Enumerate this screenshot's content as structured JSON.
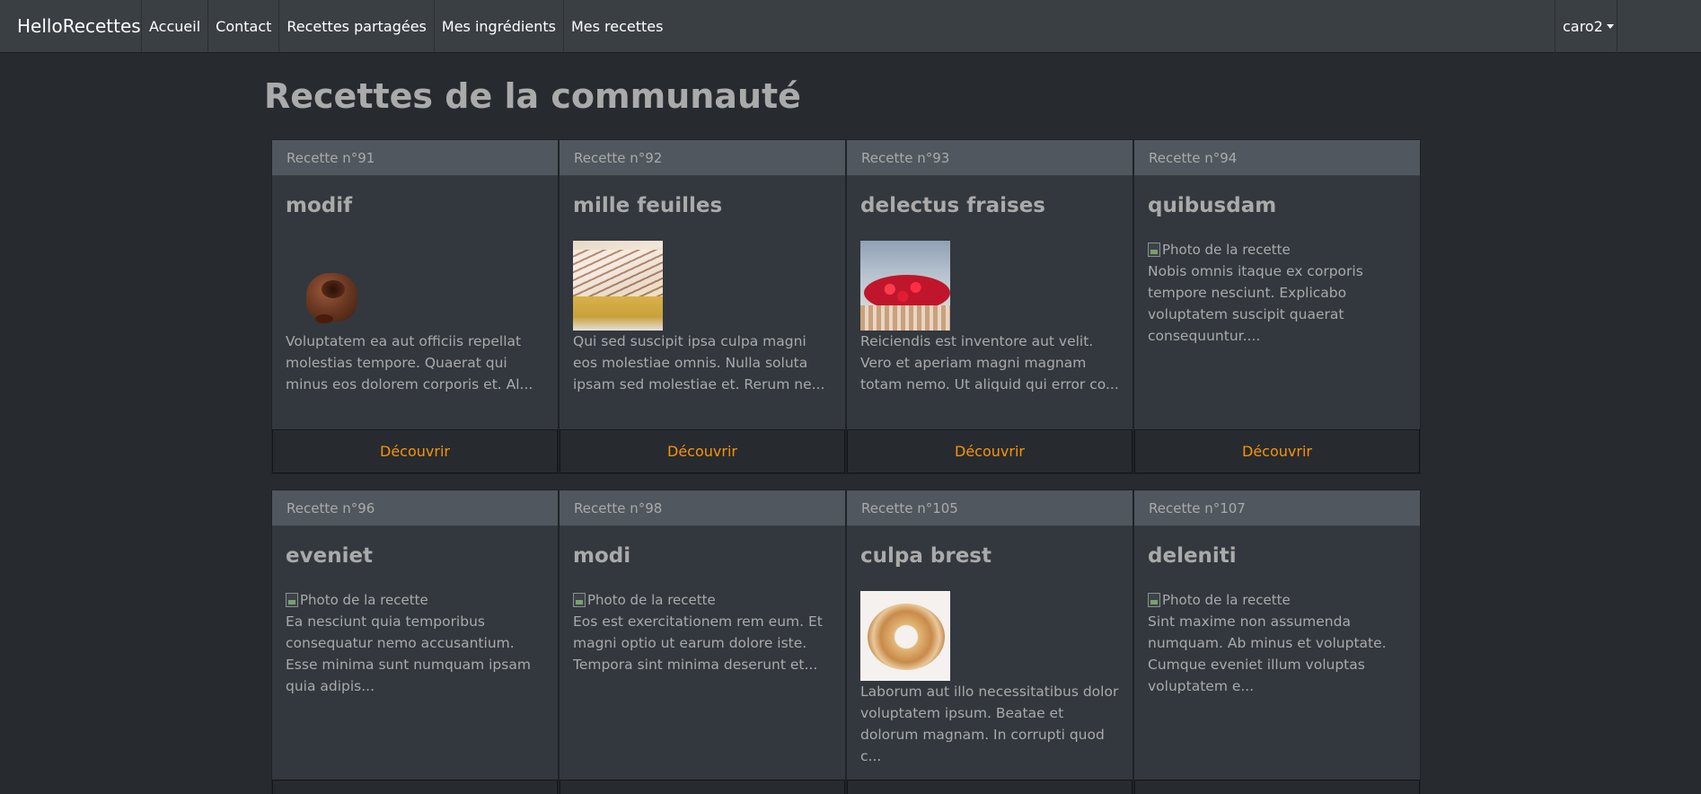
{
  "navbar": {
    "brand": "HelloRecettes",
    "links": [
      "Accueil",
      "Contact",
      "Recettes partagées",
      "Mes ingrédients",
      "Mes recettes"
    ],
    "user": "caro2"
  },
  "page_title": "Recettes de la communauté",
  "photo_alt": "Photo de la recette",
  "footer_label": "Découvrir",
  "cards": [
    {
      "header": "Recette n°91",
      "title": "modif",
      "text": "Voluptatem ea aut officiis repellat molestias tempore. Quaerat qui minus eos dolorem corporis et. Al..."
    },
    {
      "header": "Recette n°92",
      "title": "mille feuilles",
      "text": "Qui sed suscipit ipsa culpa magni eos molestiae omnis. Nulla soluta ipsam sed molestiae et. Rerum ne..."
    },
    {
      "header": "Recette n°93",
      "title": "delectus fraises",
      "text": "Reiciendis est inventore aut velit. Vero et aperiam magni magnam totam nemo. Ut aliquid qui error co..."
    },
    {
      "header": "Recette n°94",
      "title": "quibusdam",
      "text": "Nobis omnis itaque ex corporis tempore nesciunt. Explicabo voluptatem suscipit quaerat consequuntur...."
    },
    {
      "header": "Recette n°96",
      "title": "eveniet",
      "text": "Ea nesciunt quia temporibus consequatur nemo accusantium. Esse minima sunt numquam ipsam quia adipis..."
    },
    {
      "header": "Recette n°98",
      "title": "modi",
      "text": "Eos est exercitationem rem eum. Et magni optio ut earum dolore iste. Tempora sint minima deserunt et..."
    },
    {
      "header": "Recette n°105",
      "title": "culpa brest",
      "text": "Laborum aut illo necessitatibus dolor voluptatem ipsum. Beatae et dolorum magnam. In corrupti quod c..."
    },
    {
      "header": "Recette n°107",
      "title": "deleniti",
      "text": "Sint maxime non assumenda numquam. Ab minus et voluptate. Cumque eveniet illum voluptas voluptatem e..."
    }
  ],
  "colors": {
    "background": "#272b30",
    "navbar": "#3a3f44",
    "card": "#32383e",
    "card_header": "#50575e",
    "accent": "#f89406"
  }
}
